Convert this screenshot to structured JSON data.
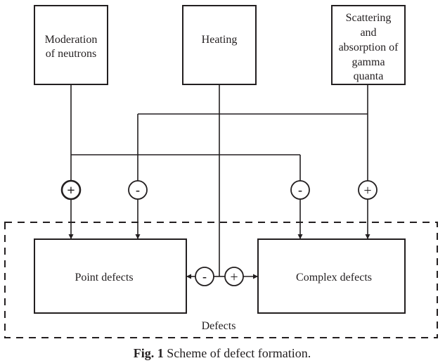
{
  "figure": {
    "caption_prefix": "Fig. 1",
    "caption_text": " Scheme of defect formation."
  },
  "colors": {
    "stroke": "#231f20",
    "background": "#ffffff"
  },
  "sources": [
    {
      "id": "moderation",
      "lines": [
        "Moderation",
        "of neutrons"
      ]
    },
    {
      "id": "heating",
      "lines": [
        "Heating"
      ]
    },
    {
      "id": "scattering",
      "lines": [
        "Scattering",
        "and",
        "absorption of",
        "gamma",
        "quanta"
      ]
    }
  ],
  "targets": {
    "point": "Point defects",
    "complex": "Complex defects",
    "group_label": "Defects"
  },
  "signs": {
    "moderation_to_point": "+",
    "scattering_to_point": "-",
    "moderation_to_complex": "-",
    "scattering_to_complex": "+",
    "heating_to_point": "-",
    "heating_to_complex": "+"
  }
}
